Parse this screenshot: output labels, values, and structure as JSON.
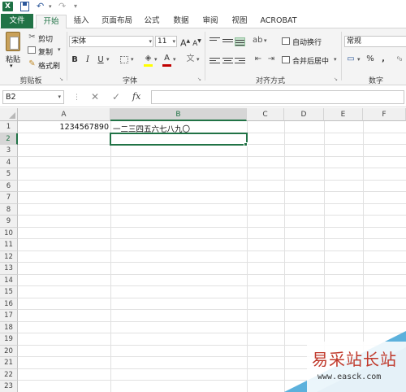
{
  "app": {
    "logo_letter": "X"
  },
  "qat": {
    "undo_glyph": "↶",
    "redo_glyph": "↷"
  },
  "tabs": [
    {
      "label": "文件"
    },
    {
      "label": "开始"
    },
    {
      "label": "插入"
    },
    {
      "label": "页面布局"
    },
    {
      "label": "公式"
    },
    {
      "label": "数据"
    },
    {
      "label": "审阅"
    },
    {
      "label": "视图"
    },
    {
      "label": "ACROBAT"
    }
  ],
  "ribbon": {
    "clipboard": {
      "paste": "粘贴",
      "cut": "剪切",
      "copy": "复制",
      "format_painter": "格式刷",
      "group_label": "剪贴板"
    },
    "font": {
      "name": "宋体",
      "size": "11",
      "grow": "A",
      "shrink": "A",
      "bold": "B",
      "italic": "I",
      "underline": "U",
      "group_label": "字体",
      "font_color": "#c00000",
      "highlight_color": "#ffff00"
    },
    "alignment": {
      "wrap_text": "自动换行",
      "merge_center": "合并后居中",
      "group_label": "对齐方式"
    },
    "number": {
      "format": "常规",
      "percent": "%",
      "comma": ",",
      "group_label": "数字"
    }
  },
  "formula_bar": {
    "name_box": "B2",
    "fx": "fx",
    "cancel": "✕",
    "enter": "✓",
    "content": ""
  },
  "grid": {
    "columns": [
      "A",
      "B",
      "C",
      "D",
      "E",
      "F"
    ],
    "rows": [
      "1",
      "2",
      "3",
      "4",
      "5",
      "6",
      "7",
      "8",
      "9",
      "10",
      "11",
      "12",
      "13",
      "14",
      "15",
      "16",
      "17",
      "18",
      "19",
      "20",
      "21",
      "22",
      "23"
    ],
    "active_cell": "B2",
    "cells": {
      "A1": "1234567890",
      "B1": "一二三四五六七八九〇"
    }
  },
  "watermark": {
    "title": "易采站长站",
    "url": "www.easck.com"
  },
  "colors": {
    "accent": "#217346"
  }
}
